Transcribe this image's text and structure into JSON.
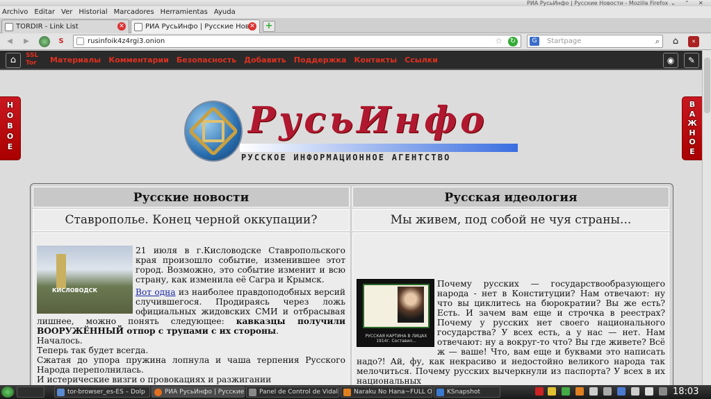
{
  "window": {
    "title": "РИА РусьИнфо | Русские Новости - Mozilla Firefox"
  },
  "menu": [
    "Archivo",
    "Editar",
    "Ver",
    "Historial",
    "Marcadores",
    "Herramientas",
    "Ayuda"
  ],
  "tabs": [
    {
      "label": "TORDIR - Link List"
    },
    {
      "label": "РИА РусьИнфо | Русские Нов..."
    }
  ],
  "url": "rusinfoik4z4rgi3.onion",
  "search": {
    "placeholder": "Startpage",
    "engine": "G"
  },
  "site": {
    "ssl_label": "SSL",
    "tor_label": "Tor",
    "nav": [
      "Материалы",
      "Комментарии",
      "Безопасность",
      "Добавить",
      "Поддержка",
      "Контакты",
      "Ссылки"
    ],
    "left_tab": [
      "Н",
      "О",
      "В",
      "О",
      "Е"
    ],
    "right_tab": [
      "В",
      "А",
      "Ж",
      "Н",
      "О",
      "Е"
    ],
    "logo_name": "РусьИнфо",
    "logo_sub": "РУССКОЕ ИНФОРМАЦИОННОЕ АГЕНТСТВО"
  },
  "left_col": {
    "heading": "Русские новости",
    "article_title": "Ставрополье. Конец черной оккупации?",
    "image_caption": "КИСЛОВОДСК",
    "p1": "21 июля в г.Кисловодске Ставропольского края произошло событие, изменившее этот город. Возможно, это событие изменит и всю страну, как изменила её Сагра и Крымск.",
    "link": "Вот одна",
    "p2_rest": " из наиболее правдоподобных версий случившегося. Продираясь через ложь официальных жидовских СМИ и отбрасывая лишнее, можно понять следующее: ",
    "p2_bold": "кавказцы получили ВООРУЖЁННЫЙ отпор с трупами с их стороны",
    "p2_end": ".",
    "lines": [
      "Началось.",
      "Теперь так будет всегда.",
      "Сжатая до упора пружина лопнула и чаша терпения Русского Народа переполнилась.",
      "И истерические визги о провокациях и разжигании"
    ]
  },
  "right_col": {
    "heading": "Русская идеология",
    "article_title": "Мы живем, под собой не чуя страны...",
    "image_caption": "РУССКАЯ КАРТИНА В ЛИЦАХ 1914г. Составил...",
    "text": "Почему русских — государствообразующего народа - нет в Конституции? Нам отвечают: ну что вы циклитесь на бюрократии? Вы же есть? Есть. И зачем вам еще и строчка в реестрах? Почему у русских нет своего национального государства? У всех есть, а у нас — нет. Нам отвечают: ну а вокруг-то что? Вы где живете? Всё ж — ваше! Что, вам еще и буквами это написать надо?! Ай, фу, как некрасиво и недостойно великого народа так мелочиться. Почему русских вычеркнули из паспорта? У всех в их национальных"
  },
  "taskbar": {
    "items": [
      "tor-browser_es-ES – Dolp",
      "РИА РусьИнфо | Русские",
      "Panel de Control de Vidali",
      "Naraku No Hana~FULL O",
      "KSnapshot"
    ],
    "clock": "18:03"
  },
  "colors": {
    "accent_red": "#e03020",
    "site_bg": "#dcdcdc",
    "nav_dark": "#2a2a2a"
  }
}
